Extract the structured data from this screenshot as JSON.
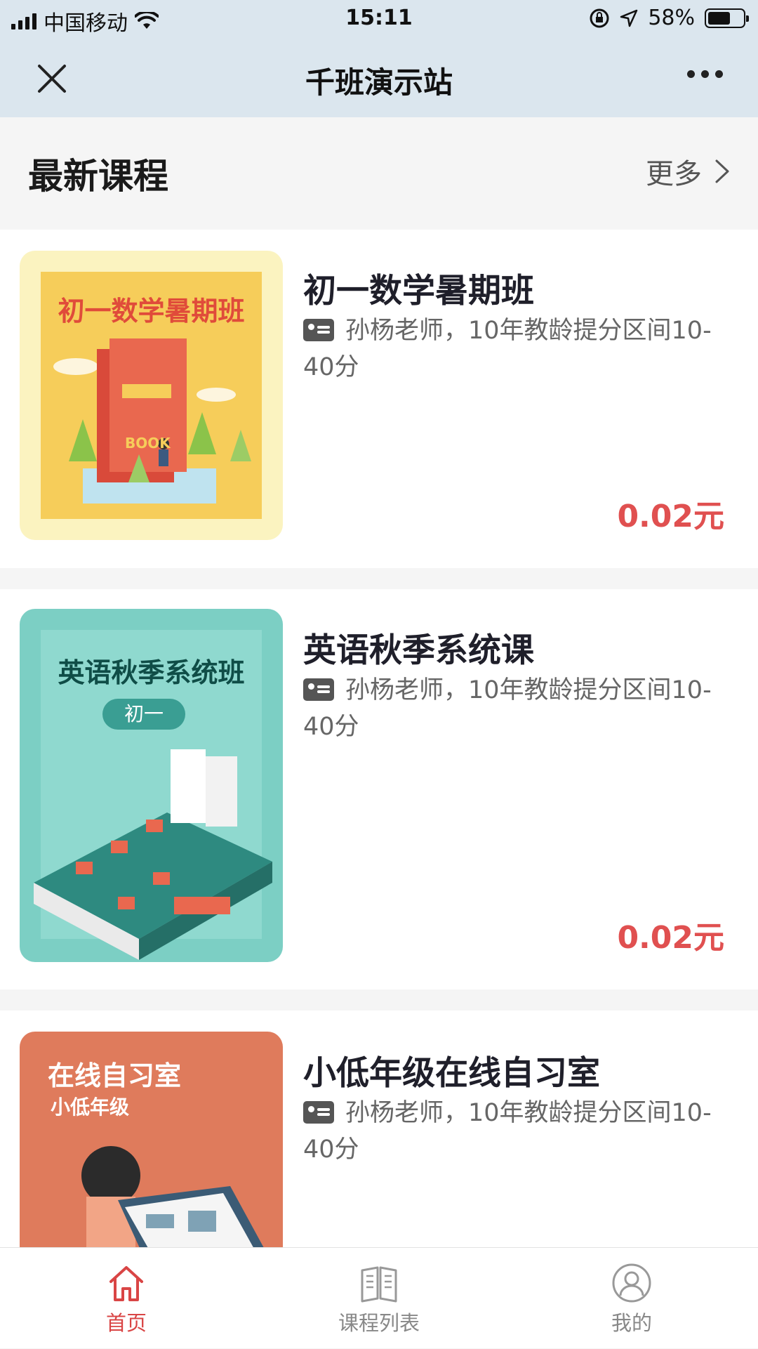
{
  "status_bar": {
    "carrier": "中国移动",
    "time": "15:11",
    "battery_percent": "58%",
    "battery_level": 0.58
  },
  "nav": {
    "title": "千班演示站",
    "close_icon": "close-icon",
    "more_icon": "more-dots-icon"
  },
  "section": {
    "title": "最新课程",
    "more_label": "更多"
  },
  "courses": [
    {
      "title": "初一数学暑期班",
      "thumb_text": "初一数学暑期班",
      "thumb_sub": "",
      "book_label": "BOOK",
      "teacher": "孙杨老师，10年教龄提分区间10-40分",
      "price": "0.02元"
    },
    {
      "title": "英语秋季系统课",
      "thumb_text": "英语秋季系统班",
      "thumb_sub": "初一",
      "teacher": "孙杨老师，10年教龄提分区间10-40分",
      "price": "0.02元"
    },
    {
      "title": "小低年级在线自习室",
      "thumb_text": "在线自习室",
      "thumb_sub": "小低年级",
      "teacher": "孙杨老师，10年教龄提分区间10-40分",
      "price": ""
    }
  ],
  "tabbar": {
    "items": [
      {
        "label": "首页",
        "icon": "home-icon",
        "active": true
      },
      {
        "label": "课程列表",
        "icon": "book-icon",
        "active": false
      },
      {
        "label": "我的",
        "icon": "user-icon",
        "active": false
      }
    ]
  },
  "colors": {
    "accent": "#d94545",
    "price": "#e05050",
    "nav_bg": "#dbe6ee",
    "page_bg": "#f5f5f5"
  }
}
